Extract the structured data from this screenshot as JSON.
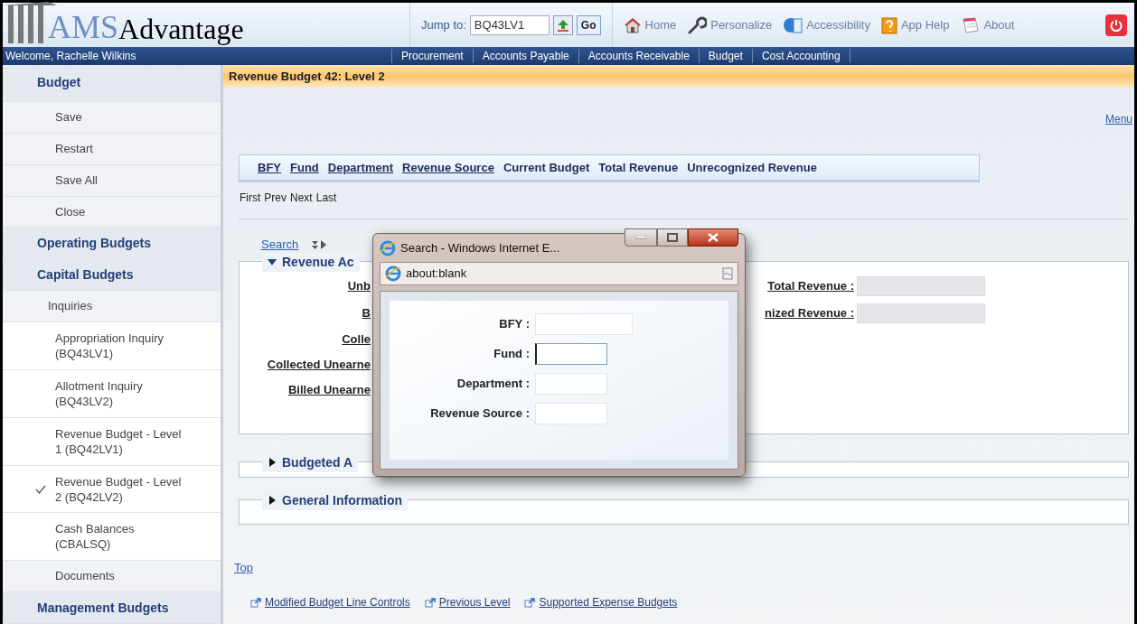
{
  "header": {
    "logo_text": "AMS",
    "logo_suffix": "Advantage",
    "jump_label": "Jump to:",
    "jump_value": "BQ43LV1",
    "go": "Go",
    "links": [
      {
        "kind": "home",
        "label": "Home"
      },
      {
        "kind": "wrench",
        "label": "Personalize"
      },
      {
        "kind": "access",
        "label": "Accessibility"
      },
      {
        "kind": "help",
        "label": "App Help"
      },
      {
        "kind": "about",
        "label": "About"
      }
    ]
  },
  "nav": {
    "welcome": "Welcome, Rachelle Wilkins",
    "tabs": [
      "Procurement",
      "Accounts Payable",
      "Accounts Receivable",
      "Budget",
      "Cost Accounting"
    ]
  },
  "sidebar": {
    "items": [
      {
        "kind": "header",
        "label": "Budget"
      },
      {
        "kind": "action",
        "label": "Save"
      },
      {
        "kind": "action",
        "label": "Restart"
      },
      {
        "kind": "action",
        "label": "Save All"
      },
      {
        "kind": "action",
        "label": "Close"
      },
      {
        "kind": "header",
        "label": "Operating Budgets"
      },
      {
        "kind": "header",
        "label": "Capital Budgets"
      },
      {
        "kind": "group",
        "label": "Inquiries"
      },
      {
        "kind": "page",
        "label": "Appropriation Inquiry (BQ43LV1)",
        "selected": false
      },
      {
        "kind": "page",
        "label": "Allotment Inquiry (BQ43LV2)",
        "selected": false
      },
      {
        "kind": "page",
        "label": "Revenue Budget - Level 1 (BQ42LV1)",
        "selected": false
      },
      {
        "kind": "page",
        "label": "Revenue Budget - Level 2 (BQ42LV2)",
        "selected": true
      },
      {
        "kind": "page",
        "label": "Cash Balances (CBALSQ)",
        "selected": false
      },
      {
        "kind": "action",
        "label": "Documents"
      },
      {
        "kind": "header",
        "label": "Management Budgets"
      }
    ]
  },
  "page": {
    "title": "Revenue Budget 42: Level 2",
    "menu": "Menu",
    "table": {
      "columns": [
        {
          "label": "BFY",
          "link": true
        },
        {
          "label": "Fund",
          "link": true
        },
        {
          "label": "Department",
          "link": true
        },
        {
          "label": "Revenue Source",
          "link": true
        },
        {
          "label": "Current Budget",
          "link": false
        },
        {
          "label": "Total Revenue",
          "link": false
        },
        {
          "label": "Unrecognized Revenue",
          "link": false
        }
      ]
    },
    "pager": [
      "First",
      "Prev",
      "Next",
      "Last"
    ],
    "search": "Search",
    "sections": [
      {
        "title": "Revenue Ac",
        "expanded": true,
        "left_labels": [
          "Unb",
          "B",
          "Colle",
          "Collected Unearne",
          "Billed Unearne"
        ],
        "right_fields": [
          {
            "label": "Total Revenue :"
          },
          {
            "label": "nized Revenue :"
          }
        ]
      },
      {
        "title": "Budgeted A",
        "expanded": false
      },
      {
        "title": "General Information",
        "expanded": false
      }
    ],
    "top": "Top",
    "links": [
      "Modified Budget Line Controls",
      "Previous Level",
      "Supported Expense Budgets"
    ]
  },
  "popup": {
    "title": "Search - Windows Internet E...",
    "address": "about:blank",
    "fields": [
      {
        "label": "BFY :",
        "focused": false
      },
      {
        "label": "Fund :",
        "focused": true
      },
      {
        "label": "Department :",
        "focused": false
      },
      {
        "label": "Revenue Source :",
        "focused": false
      }
    ]
  }
}
